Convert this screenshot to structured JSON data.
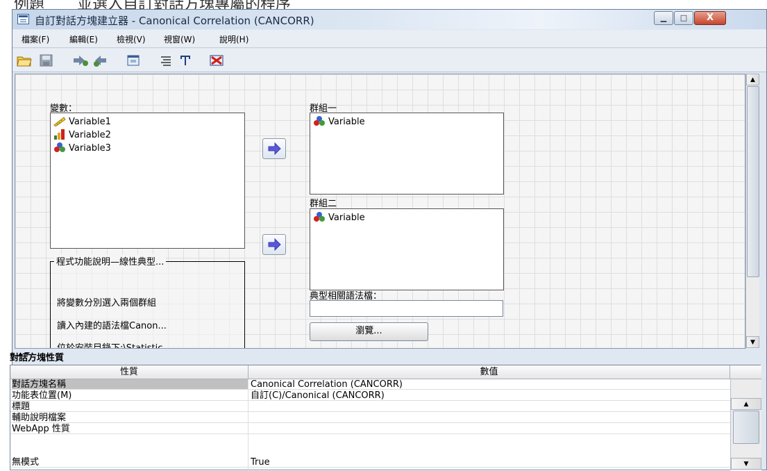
{
  "caption": {
    "fragment_1": "例題",
    "fragment_2": "並選入自訂對話方塊專屬的程序"
  },
  "window": {
    "title": "自訂對話方塊建立器 - Canonical Correlation (CANCORR)",
    "controls": {
      "minimize": "▁",
      "maximize": "□",
      "close": "X"
    }
  },
  "menu": {
    "items": [
      "檔案(F)",
      "編輯(E)",
      "檢視(V)",
      "視窗(W)",
      "說明(H)"
    ]
  },
  "toolbar": {
    "icons": [
      "open-folder-icon",
      "save-icon",
      "forward-icon",
      "back-icon",
      "preview-icon",
      "list-icon",
      "text-icon",
      "delete-icon"
    ]
  },
  "canvas": {
    "variables_label": "變數：",
    "variables": [
      {
        "label": "Variable1",
        "icon": "scale-ruler-icon"
      },
      {
        "label": "Variable2",
        "icon": "ordinal-bar-icon"
      },
      {
        "label": "Variable3",
        "icon": "nominal-balls-icon"
      }
    ],
    "group1_label": "群組一",
    "group1_items": [
      "Variable"
    ],
    "group2_label": "群組二",
    "group2_items": [
      "Variable"
    ],
    "description_title": "程式功能說明—線性典型...",
    "description_lines": [
      "將變數分別選入兩個群組",
      "讀入內建的語法檔Canon...",
      "位於安裝目錄下:\\Statistic..."
    ],
    "syntax_label": "典型相關語法檔：",
    "syntax_value": "",
    "browse_label": "瀏覽..."
  },
  "properties": {
    "title": "對話方塊性質",
    "headers": [
      "性質",
      "數值"
    ],
    "rows": [
      {
        "key": "對話方塊名稱",
        "value": "Canonical Correlation (CANCORR)",
        "selected": true
      },
      {
        "key": "功能表位置(M)",
        "value": "自訂(C)/Canonical (CANCORR)"
      },
      {
        "key": "標題",
        "value": ""
      },
      {
        "key": "輔助說明檔案",
        "value": ""
      },
      {
        "key": "WebApp 性質",
        "value": ""
      },
      {
        "key": "無模式",
        "value": "True"
      }
    ]
  }
}
